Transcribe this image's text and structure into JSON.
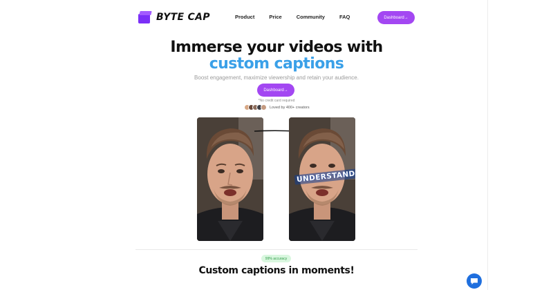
{
  "brand": {
    "name": "BYTE CAP",
    "color": "#7b2ff7"
  },
  "nav": {
    "links": [
      "Product",
      "Price",
      "Community",
      "FAQ"
    ],
    "cta_label": "Dashboard→"
  },
  "hero": {
    "title": "Immerse your videos with",
    "accent": "custom captions",
    "subtitle": "Boost engagement, maximize viewership and retain your audience.",
    "cta_label": "Dashboard→",
    "no_card": "*No credit card required",
    "loved": "Loved by 400+ creators",
    "accent_color": "#3aa0e8",
    "button_color": "#a347f2"
  },
  "demo": {
    "caption_word": "UNDERSTAND"
  },
  "feature": {
    "badge": "99% accuracy",
    "title": "Custom captions in moments!"
  },
  "icons": {
    "chat": "chat-bubble-icon",
    "arrow": "right-arrow-icon"
  }
}
